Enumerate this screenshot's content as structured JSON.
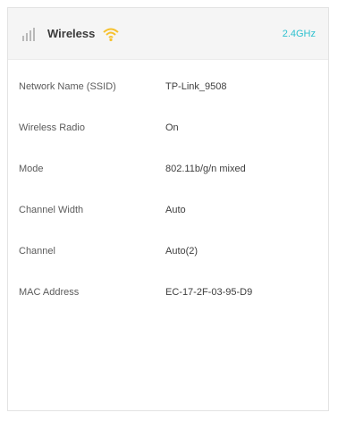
{
  "header": {
    "title": "Wireless",
    "band": "2.4GHz",
    "icon": "wireless-signal-icon",
    "status_icon": "wifi-icon",
    "accent_color": "#f6c12d",
    "band_color": "#2fc1cf"
  },
  "details": [
    {
      "label": "Network Name (SSID)",
      "value": "TP-Link_9508"
    },
    {
      "label": "Wireless Radio",
      "value": "On"
    },
    {
      "label": "Mode",
      "value": "802.11b/g/n mixed"
    },
    {
      "label": "Channel Width",
      "value": "Auto"
    },
    {
      "label": "Channel",
      "value": "Auto(2)"
    },
    {
      "label": "MAC Address",
      "value": "EC-17-2F-03-95-D9"
    }
  ]
}
